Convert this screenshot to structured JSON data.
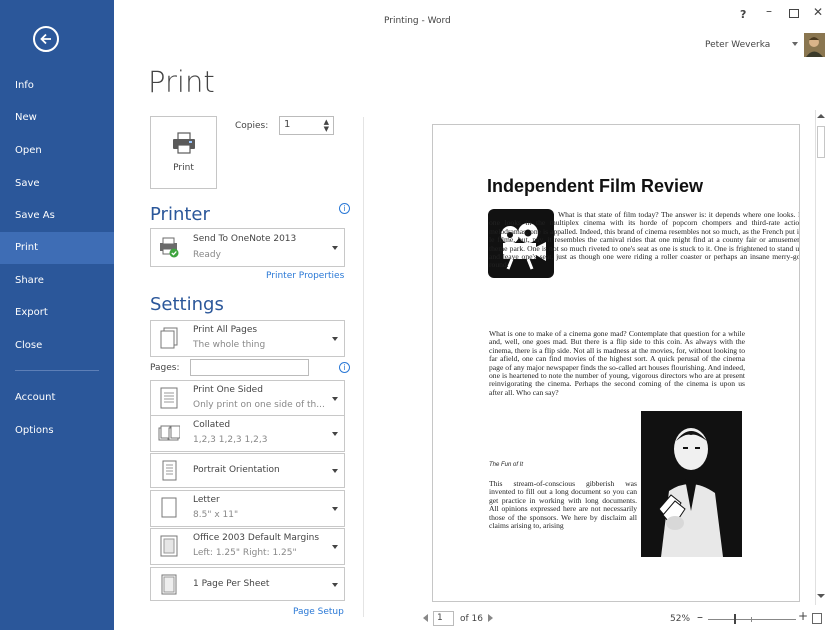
{
  "window": {
    "title": "Printing - Word",
    "help": "?",
    "minimize": "–",
    "close": "✕",
    "user_name": "Peter Weverka"
  },
  "nav": {
    "items": [
      {
        "label": "Info"
      },
      {
        "label": "New"
      },
      {
        "label": "Open"
      },
      {
        "label": "Save"
      },
      {
        "label": "Save As"
      },
      {
        "label": "Print",
        "active": true
      },
      {
        "label": "Share"
      },
      {
        "label": "Export"
      },
      {
        "label": "Close"
      },
      {
        "label": "Account"
      },
      {
        "label": "Options"
      }
    ]
  },
  "print": {
    "heading": "Print",
    "print_button_label": "Print",
    "copies_label": "Copies:",
    "copies_value": "1"
  },
  "printer": {
    "heading": "Printer",
    "name": "Send To OneNote 2013",
    "status": "Ready",
    "properties_link": "Printer Properties"
  },
  "settings": {
    "heading": "Settings",
    "pages_label": "Pages:",
    "pages_value": "",
    "page_setup_link": "Page Setup",
    "items": [
      {
        "line1": "Print All Pages",
        "line2": "The whole thing"
      },
      {
        "line1": "Print One Sided",
        "line2": "Only print on one side of th..."
      },
      {
        "line1": "Collated",
        "line2": "1,2,3   1,2,3   1,2,3"
      },
      {
        "line1": "Portrait Orientation",
        "line2": ""
      },
      {
        "line1": "Letter",
        "line2": "8.5\" x 11\""
      },
      {
        "line1": "Office 2003 Default Margins",
        "line2": "Left: 1.25\"   Right: 1.25\""
      },
      {
        "line1": "1 Page Per Sheet",
        "line2": ""
      }
    ]
  },
  "preview": {
    "doc_title": "Independent Film Review",
    "para1": "What is that state of film today? The answer is: it depends where one looks. If one looks in the multiplex cinema with its horde of popcorn chompers and third-rate action melodramas, one is appalled. Indeed, this brand of cinema resembles not so much, as the French put it, le filme, but, nay, it resembles the carnival rides that one might find at a county fair or amusement theme park. One is not so much riveted to one's seat as one is stuck to it. One is frightened to stand up and leave one's seat, just as though one were riding a roller coaster or perhaps an insane merry-go-round.",
    "para2": "What is one to make of a cinema gone mad? Contemplate that question for a while and, well, one goes mad. But there is a flip side to this coin. As always with the cinema, there is a flip side. Not all is madness at the movies, for, without looking to far afield, one can find movies of the highest sort. A quick perusal of the cinema page of any major newspaper finds the so-called art houses flourishing. And indeed, one is heartened to note the number of young, vigorous directors who are at present reinvigorating the cinema. Perhaps the second coming of the cinema is upon us after all. Who can say?",
    "subhead": "The Fun of It",
    "para3": "This stream-of-conscious gibberish was invented to fill out a long document so you can get practice in working with long documents. All opinions expressed here are not necessarily those of the sponsors. We here by disclaim all claims arising to, arising"
  },
  "pager": {
    "current_page": "1",
    "of_pages": "of 16",
    "zoom": "52%",
    "zoom_minus": "–",
    "zoom_plus": "+"
  },
  "colors": {
    "nav_bg": "#2b579a",
    "nav_active": "#3e6db5",
    "accent": "#2b579a",
    "link": "#2b79d6"
  }
}
